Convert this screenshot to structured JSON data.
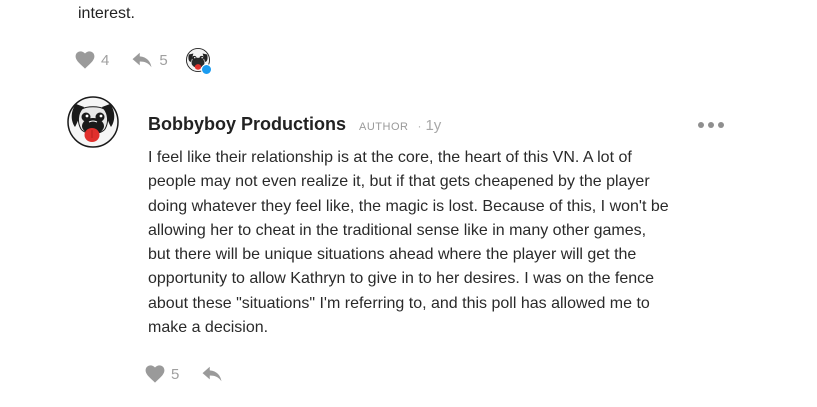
{
  "previous_comment": {
    "tail_text": "interest.",
    "likes": "4",
    "replies": "5"
  },
  "comment": {
    "author": "Bobbyboy Productions",
    "role": "AUTHOR",
    "separator": "·",
    "age": "1y",
    "lines": [
      "I feel like their relationship is at the core, the heart of this VN. A lot of",
      "people may not even realize it, but if that gets cheapened by the player",
      "doing whatever they feel like, the magic is lost. Because of this, I won't be",
      "allowing her to cheat in the traditional sense like in many other games,",
      "but there will be unique situations ahead where the player will get the",
      "opportunity to allow Kathryn to give in to her desires. I was on the fence",
      "about these \"situations\" I'm referring to, and this poll has allowed me to",
      "make a decision."
    ],
    "likes": "5"
  },
  "icons": {
    "heart": "heart-icon",
    "reply": "reply-icon",
    "more": "more-options-icon",
    "avatar": "pug-avatar"
  },
  "colors": {
    "icon_gray": "#9a9a9a",
    "badge_blue": "#1a9bf0",
    "text": "#2a2a2a",
    "tongue_red": "#e0302c"
  }
}
